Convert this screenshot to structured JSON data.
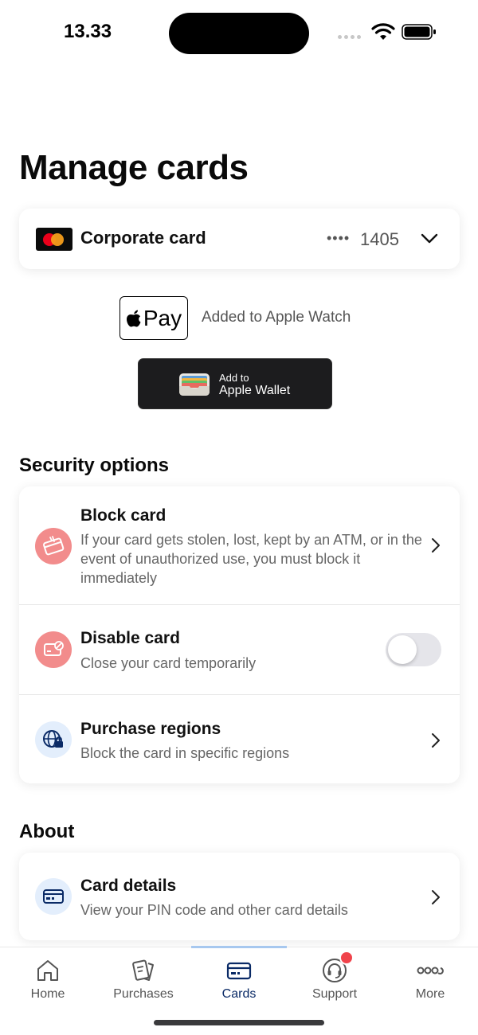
{
  "status_bar": {
    "time": "13.33"
  },
  "page": {
    "title": "Manage cards"
  },
  "card_selector": {
    "name": "Corporate card",
    "masked_dots": "••••",
    "last4": "1405"
  },
  "apple_pay": {
    "badge_text": "Pay",
    "status": "Added to Apple Watch"
  },
  "wallet_button": {
    "line1": "Add to",
    "line2": "Apple Wallet"
  },
  "security": {
    "heading": "Security options",
    "items": [
      {
        "title": "Block card",
        "description": "If your card gets stolen, lost, kept by an ATM, or in the event of unauthorized use, you must block it immediately",
        "icon": "blocked-card-icon"
      },
      {
        "title": "Disable card",
        "description": "Close your card temporarily",
        "icon": "disabled-card-icon",
        "toggle_on": false
      },
      {
        "title": "Purchase regions",
        "description": "Block the card in specific regions",
        "icon": "globe-lock-icon"
      }
    ]
  },
  "about": {
    "heading": "About",
    "items": [
      {
        "title": "Card details",
        "description": "View your PIN code and other card details",
        "icon": "card-icon"
      }
    ]
  },
  "tabs": [
    {
      "label": "Home",
      "icon": "home-icon"
    },
    {
      "label": "Purchases",
      "icon": "receipts-icon"
    },
    {
      "label": "Cards",
      "icon": "card-icon",
      "active": true
    },
    {
      "label": "Support",
      "icon": "headset-icon",
      "badge": true
    },
    {
      "label": "More",
      "icon": "more-icon"
    }
  ],
  "colors": {
    "accent": "#0a2a66",
    "danger_icon_bg": "#f28c8c",
    "info_icon_bg": "#e3eefc",
    "badge": "#f0434b"
  }
}
